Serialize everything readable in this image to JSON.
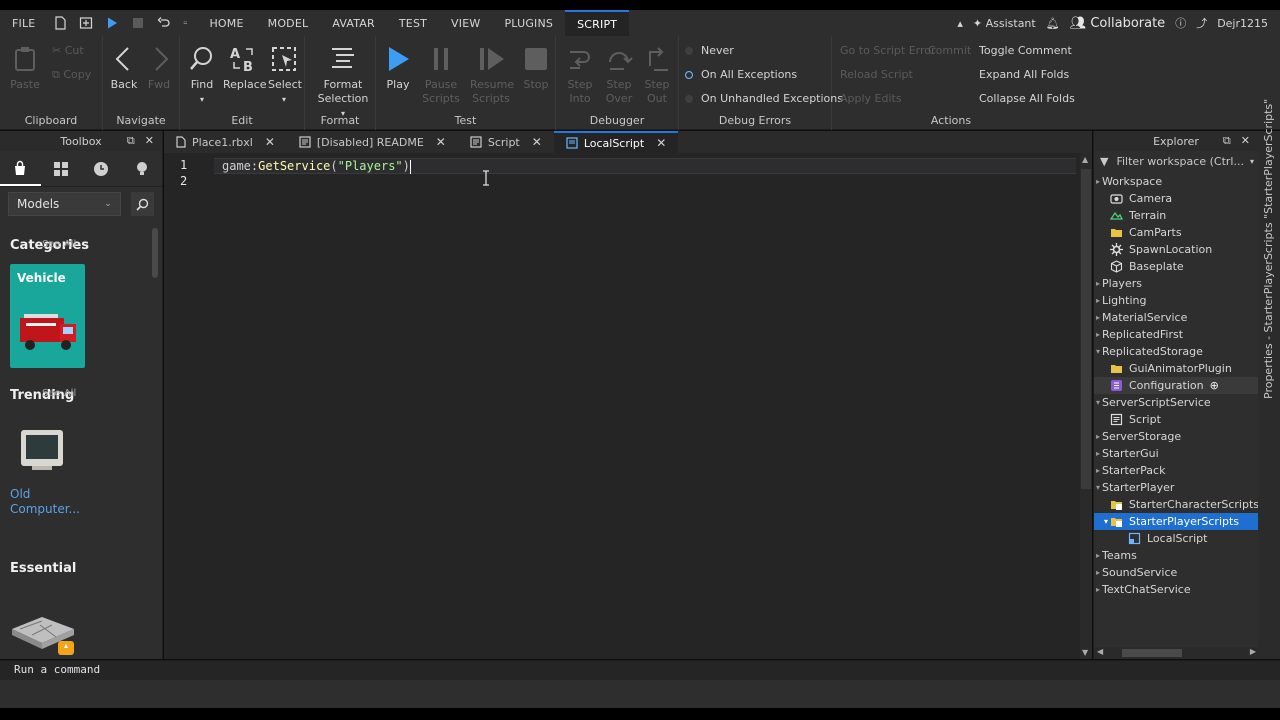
{
  "menu": {
    "file": "FILE",
    "tabs": [
      "HOME",
      "MODEL",
      "AVATAR",
      "TEST",
      "VIEW",
      "PLUGINS",
      "SCRIPT"
    ],
    "assistant": "Assistant",
    "collaborate": "Collaborate",
    "username": "Dejr1215"
  },
  "ribbon": {
    "clipboard": {
      "label": "Clipboard",
      "paste": "Paste",
      "cut": "Cut",
      "copy": "Copy"
    },
    "navigate": {
      "label": "Navigate",
      "back": "Back",
      "fwd": "Fwd"
    },
    "edit": {
      "label": "Edit",
      "find": "Find",
      "replace": "Replace",
      "select": "Select"
    },
    "format": {
      "label": "Format",
      "format_selection_1": "Format",
      "format_selection_2": "Selection"
    },
    "test": {
      "label": "Test",
      "play": "Play",
      "pause_1": "Pause",
      "pause_2": "Scripts",
      "resume_1": "Resume",
      "resume_2": "Scripts",
      "stop": "Stop"
    },
    "debugger": {
      "label": "Debugger",
      "step_into_1": "Step",
      "step_into_2": "Into",
      "step_over_1": "Step",
      "step_over_2": "Over",
      "step_out_1": "Step",
      "step_out_2": "Out"
    },
    "debug_errors": {
      "label": "Debug Errors",
      "never": "Never",
      "on_all": "On All Exceptions",
      "on_unhandled": "On Unhandled Exceptions"
    },
    "actions": {
      "label": "Actions",
      "goto_error": "Go to Script Error",
      "commit": "Commit",
      "reload": "Reload Script",
      "apply_edits": "Apply Edits",
      "toggle_comment": "Toggle Comment",
      "expand_all": "Expand All Folds",
      "collapse_all": "Collapse All Folds"
    }
  },
  "toolbox": {
    "title": "Toolbox",
    "category_select": "Models",
    "categories_heading": "Categories",
    "see_all_1": "See All",
    "vehicle_label": "Vehicle",
    "trending_heading": "Trending",
    "see_all_2": "See All",
    "trending_item_1": "Old",
    "trending_item_2": "Computer...",
    "essential_heading": "Essential"
  },
  "editor": {
    "tabs": [
      {
        "label": "Place1.rbxl"
      },
      {
        "label": "[Disabled] README"
      },
      {
        "label": "Script"
      },
      {
        "label": "LocalScript"
      }
    ],
    "line_numbers": [
      "1",
      "2"
    ],
    "code": {
      "ident": "game",
      "colon": ":",
      "method": "GetService",
      "open": "(",
      "string": "\"Players\"",
      "close": ")"
    }
  },
  "explorer": {
    "title": "Explorer",
    "filter_placeholder": "Filter workspace (Ctrl...",
    "nodes": [
      "Workspace",
      "Camera",
      "Terrain",
      "CamParts",
      "SpawnLocation",
      "Baseplate",
      "Players",
      "Lighting",
      "MaterialService",
      "ReplicatedFirst",
      "ReplicatedStorage",
      "GuiAnimatorPlugin",
      "Configuration",
      "ServerScriptService",
      "Script",
      "ServerStorage",
      "StarterGui",
      "StarterPack",
      "StarterPlayer",
      "StarterCharacterScripts",
      "StarterPlayerScripts",
      "LocalScript",
      "Teams",
      "SoundService",
      "TextChatService"
    ]
  },
  "properties_strip": "Properties - StarterPlayerScripts \"StarterPlayerScripts\"",
  "command_bar": {
    "placeholder": "Run a command"
  },
  "colors": {
    "accent": "#1f7ae0",
    "selection": "#1f6fd1",
    "play": "#3d9df2",
    "link": "#5aa2e8"
  }
}
